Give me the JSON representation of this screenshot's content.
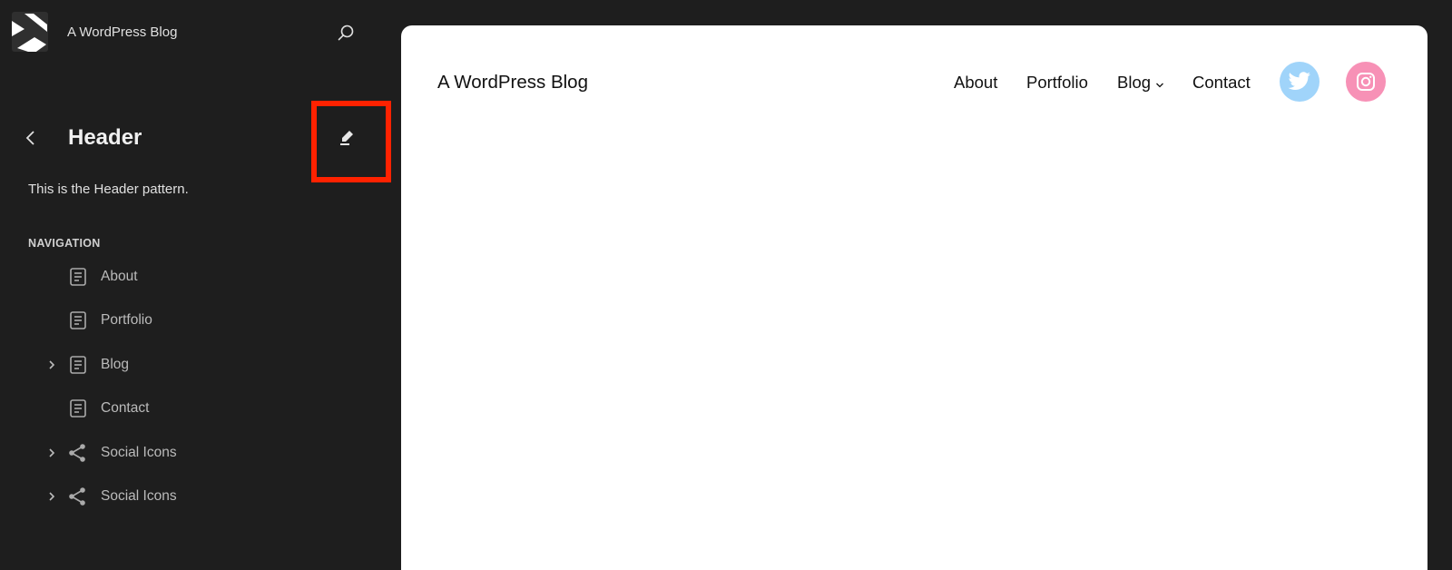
{
  "site_hub": {
    "logo_icon": "site-logo-icon",
    "site_title": "A WordPress Blog",
    "search_icon": "search-icon"
  },
  "screen": {
    "back_icon": "chevron-left-icon",
    "title": "Header",
    "edit_icon": "pencil-icon",
    "description": "This is the Header pattern.",
    "highlight_color": "#ff2200"
  },
  "navigation": {
    "heading": "NAVIGATION",
    "items": [
      {
        "label": "About",
        "icon": "page-icon",
        "expandable": false
      },
      {
        "label": "Portfolio",
        "icon": "page-icon",
        "expandable": false
      },
      {
        "label": "Blog",
        "icon": "page-icon",
        "expandable": true
      },
      {
        "label": "Contact",
        "icon": "page-icon",
        "expandable": false
      },
      {
        "label": "Social Icons",
        "icon": "share-icon",
        "expandable": true
      },
      {
        "label": "Social Icons",
        "icon": "share-icon",
        "expandable": true
      }
    ]
  },
  "preview": {
    "site_title": "A WordPress Blog",
    "nav": [
      {
        "label": "About"
      },
      {
        "label": "Portfolio"
      },
      {
        "label": "Blog",
        "has_submenu": true
      },
      {
        "label": "Contact"
      }
    ],
    "social": [
      {
        "name": "twitter",
        "icon": "twitter-icon",
        "color": "#a0d4fa"
      },
      {
        "name": "instagram",
        "icon": "instagram-icon",
        "color": "#f791b6"
      }
    ]
  },
  "colors": {
    "sidebar_bg": "#1e1e1e",
    "canvas_bg": "#ffffff"
  }
}
